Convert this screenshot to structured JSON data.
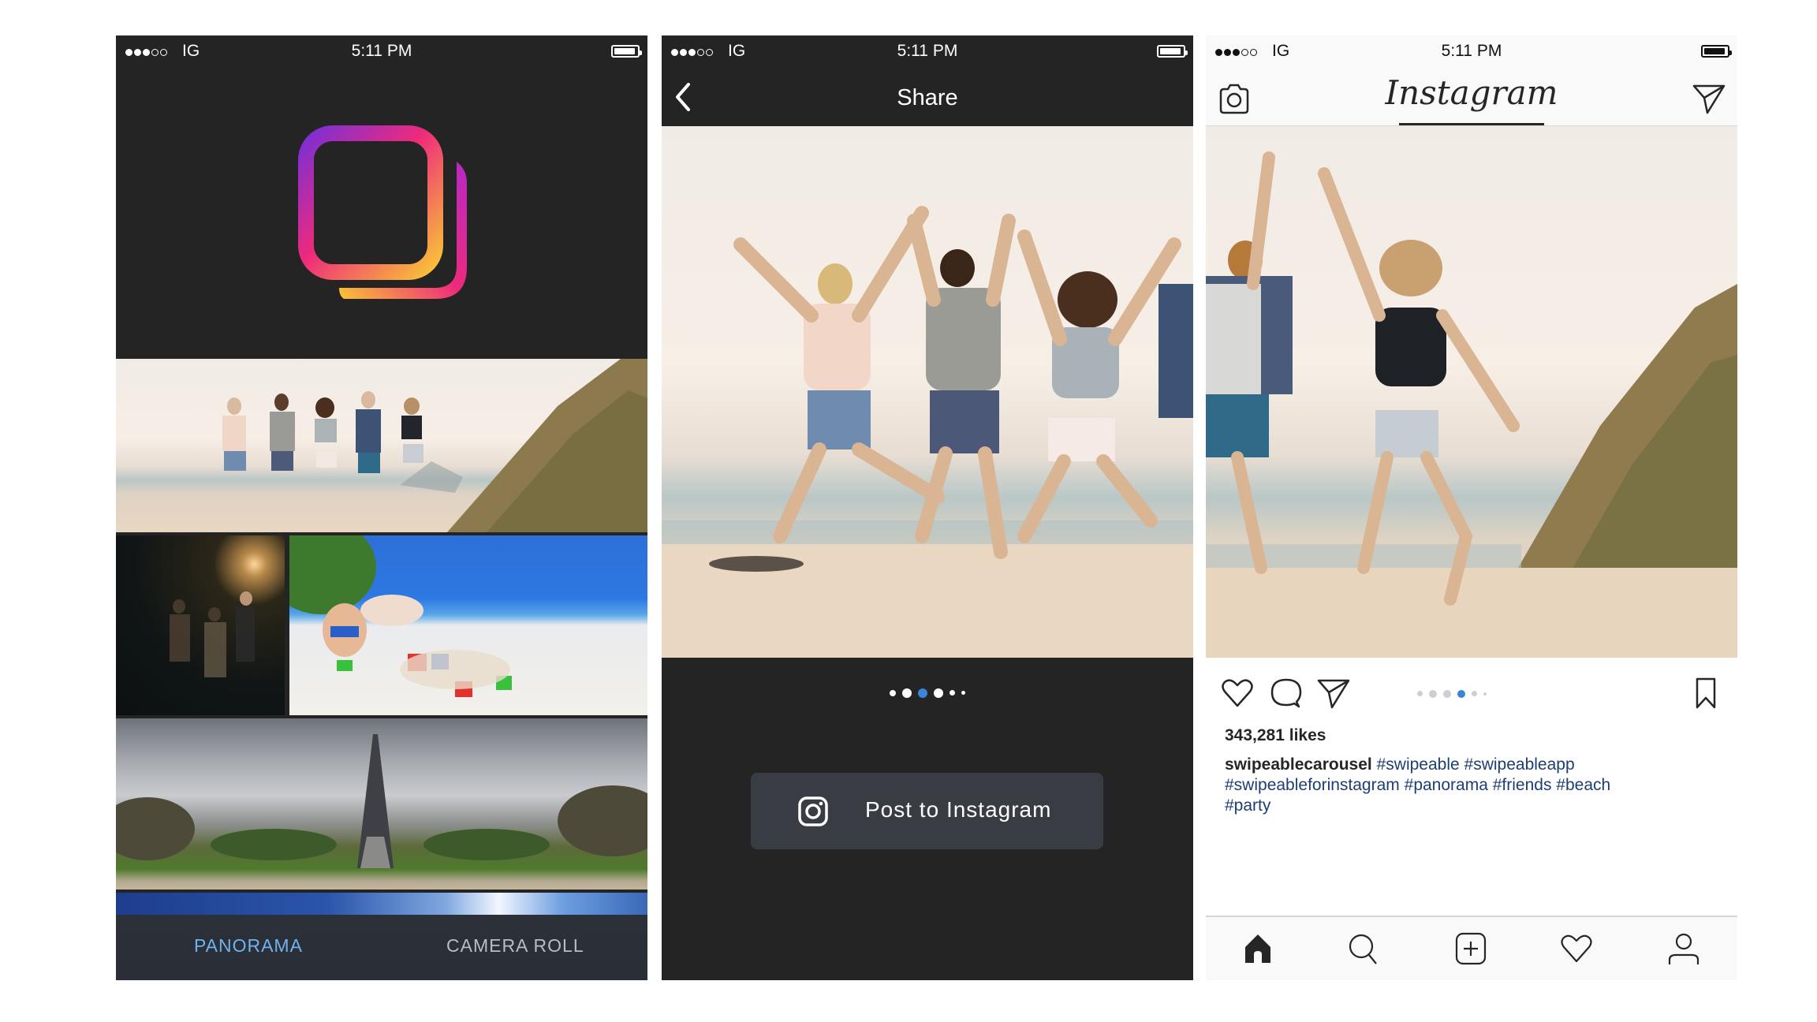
{
  "status_bar": {
    "signal_filled": 3,
    "signal_total": 5,
    "carrier": "IG",
    "time": "5:11 PM"
  },
  "screens": {
    "picker": {
      "logo": "swipeable-logo",
      "photos": [
        {
          "name": "beach-jump-panorama"
        },
        {
          "name": "night-party"
        },
        {
          "name": "kid-sandcastle"
        },
        {
          "name": "eiffel-tower-panorama"
        }
      ],
      "tabs": [
        {
          "label": "PANORAMA",
          "active": true
        },
        {
          "label": "CAMERA ROLL",
          "active": false
        }
      ]
    },
    "share": {
      "title": "Share",
      "back_icon": "chevron-left-icon",
      "carousel": {
        "count": 6,
        "active_index": 2
      },
      "post_button": {
        "icon": "instagram-icon",
        "label": "Post to Instagram"
      }
    },
    "feed": {
      "wordmark": "Instagram",
      "header_icons": [
        "camera-icon",
        "direct-message-icon"
      ],
      "carousel": {
        "count": 6,
        "active_index": 3
      },
      "likes": "343,281 likes",
      "caption": {
        "username": "swipeablecarousel",
        "hashtags": [
          "#swipeable",
          "#swipeableapp",
          "#swipeableforinstagram",
          "#panorama",
          "#friends",
          "#beach",
          "#party"
        ]
      },
      "action_icons": [
        "heart-icon",
        "comment-icon",
        "share-icon",
        "bookmark-icon"
      ],
      "bottom_nav": [
        "home-icon",
        "search-icon",
        "add-post-icon",
        "activity-heart-icon",
        "profile-icon"
      ]
    }
  },
  "colors": {
    "dark_bg": "#242424",
    "accent_blue": "#3a85d8",
    "tab_active": "#6fb2ee",
    "hashtag": "#1d3e72",
    "button_bg": "#393c43"
  }
}
